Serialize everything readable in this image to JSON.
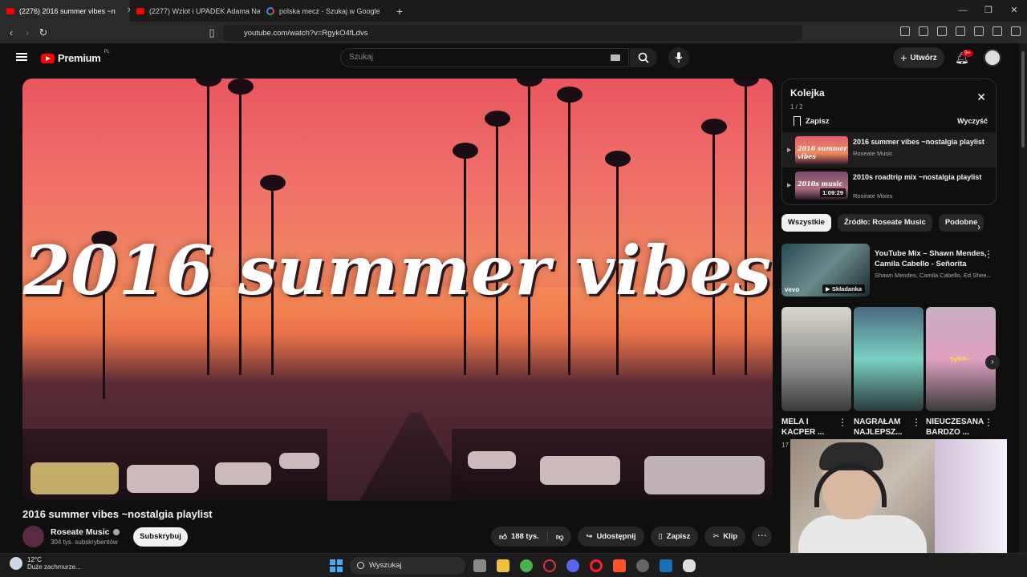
{
  "browser": {
    "tabs": [
      {
        "label": "(2276) 2016 summer vibes ~n",
        "active": true
      },
      {
        "label": "(2277) Wzlot i UPADEK Adama Nawa",
        "active": false
      },
      {
        "label": "polska mecz - Szukaj w Google",
        "active": false
      }
    ],
    "url": "youtube.com/watch?v=RgykO4fLdvs"
  },
  "header": {
    "logo_text": "Premium",
    "logo_region": "PL",
    "search_placeholder": "Szukaj",
    "create_label": "Utwórz",
    "notif_badge": "9+"
  },
  "player": {
    "overlay_title": "2016 summer vibes"
  },
  "video": {
    "title": "2016 summer vibes ~nostalgia playlist",
    "channel": "Roseate Music",
    "subscribers": "304 tys. subskrybentów",
    "subscribe_label": "Subskrybuj",
    "likes": "188 tys.",
    "share_label": "Udostępnij",
    "save_label": "Zapisz",
    "clip_label": "Klip"
  },
  "queue": {
    "title": "Kolejka",
    "count": "1 / 2",
    "save_label": "Zapisz",
    "clear_label": "Wyczyść",
    "items": [
      {
        "title": "2016 summer vibes ~nostalgia playlist",
        "channel": "Roseate Music",
        "thumb_text": "2016 summer vibes",
        "duration": ""
      },
      {
        "title": "2010s roadtrip mix ~nostalgia playlist",
        "channel": "Roseate Mixes",
        "thumb_text": "2010s music",
        "duration": "1:09:29"
      }
    ]
  },
  "chips": [
    "Wszystkie",
    "Źródło: Roseate Music",
    "Podobne"
  ],
  "recommendation": {
    "title": "YouTube Mix – Shawn Mendes, Camila Cabello - Señorita",
    "channels": "Shawn Mendes, Camila Cabello, Ed Shee...",
    "badge": "Składanka",
    "brand": "vevo"
  },
  "shorts": [
    {
      "title": "MELA I KACPER ...",
      "sub": "17"
    },
    {
      "title": "NAGRAŁAM NAJLEPSZ...",
      "sub": ""
    },
    {
      "title": "Nieuczesana BARDZO ...",
      "sub": ""
    }
  ],
  "short_tag": "Tylko...",
  "taskbar": {
    "temp": "12°C",
    "weather": "Duże zachmurze...",
    "search": "Wyszukaj"
  }
}
